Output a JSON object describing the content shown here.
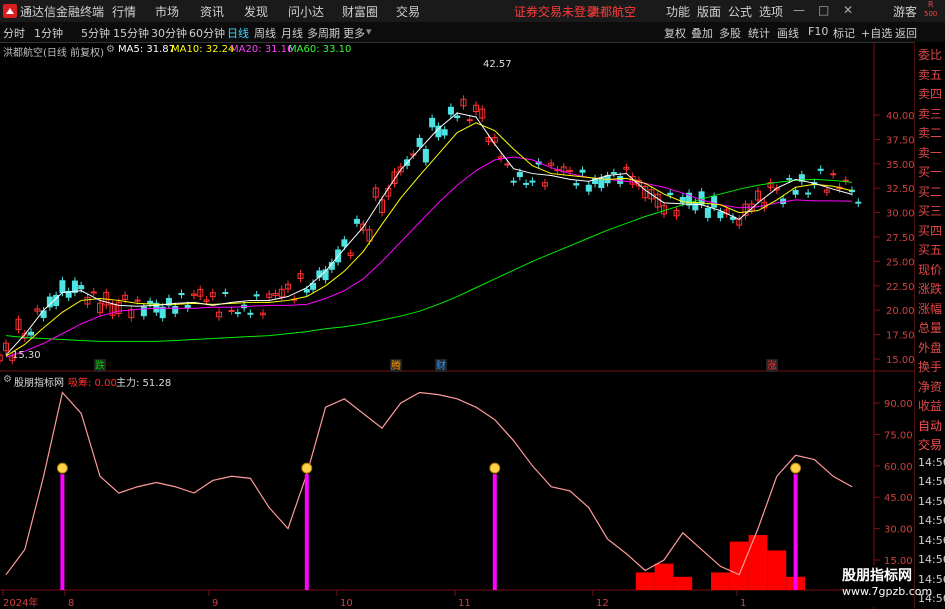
{
  "topbar": {
    "app_title": "通达信金融终端",
    "menu": [
      "行情",
      "市场",
      "资讯",
      "发现",
      "问小达",
      "财富圈",
      "交易"
    ],
    "account_status": "证券交易未登录",
    "stock_name": "洪都航空",
    "right_menu": [
      "功能",
      "版面",
      "公式",
      "选项"
    ],
    "guest": "游客",
    "r_label": "R",
    "r_num": "500"
  },
  "toolbar": {
    "periods": [
      "分时",
      "1分钟",
      "5分钟",
      "15分钟",
      "30分钟",
      "60分钟",
      "日线",
      "周线",
      "月线",
      "多周期",
      "更多"
    ],
    "active_period": "日线",
    "right_buttons": [
      "复权",
      "叠加",
      "多股",
      "统计",
      "画线",
      "F10",
      "标记",
      "+自选",
      "返回"
    ]
  },
  "chart_header": {
    "title": "洪都航空(日线 前复权)",
    "ma5": "MA5: 31.87",
    "ma10": "MA10: 32.24",
    "ma20": "MA20: 31.16",
    "ma60": "MA60: 33.10",
    "colors": {
      "ma5": "#ffffff",
      "ma10": "#ffff00",
      "ma20": "#ff00ff",
      "ma60": "#00ff00"
    }
  },
  "price_axis": [
    "40.00",
    "37.50",
    "35.00",
    "32.50",
    "30.00",
    "27.50",
    "25.00",
    "22.50",
    "20.00",
    "17.50",
    "15.00"
  ],
  "annotations": {
    "high": "42.57",
    "low": "15.30"
  },
  "event_markers": [
    {
      "label": "跌",
      "color": "#00cc00"
    },
    {
      "label": "腾",
      "color": "#ff9900"
    },
    {
      "label": "财",
      "color": "#3399ff"
    },
    {
      "label": "涨",
      "color": "#ff3030"
    }
  ],
  "indicator_header": {
    "name": "股朋指标网",
    "xi_label": "吸筹: 0.00",
    "main_label": "主力: 51.28"
  },
  "indicator_axis": [
    "90.00",
    "75.00",
    "60.00",
    "45.00",
    "30.00",
    "15.00"
  ],
  "date_axis": [
    "2024年",
    "8",
    "9",
    "10",
    "11",
    "12",
    "1"
  ],
  "right_panel": {
    "items": [
      "委比",
      "卖五",
      "卖四",
      "卖三",
      "卖二",
      "卖一",
      "买一",
      "买二",
      "买三",
      "买四",
      "买五",
      "现价",
      "涨跌",
      "涨幅",
      "总量",
      "外盘",
      "换手",
      "净资",
      "收益",
      "自动",
      "交易",
      "14:56",
      "14:56",
      "14:56",
      "14:56",
      "14:56",
      "14:56",
      "14:56",
      "14:56"
    ]
  },
  "watermark": {
    "cn": "股朋指标网",
    "url": "www.7gpzb.com"
  },
  "chart_data": {
    "type": "line",
    "x_note": "trading days Jul 2024 – Jan 2025 (daily)",
    "y_range": [
      14,
      43
    ],
    "series": [
      {
        "name": "MA60",
        "values": [
          17.4,
          17.2,
          17.1,
          17.0,
          16.9,
          16.8,
          16.8,
          16.8,
          16.8,
          16.9,
          17.0,
          17.1,
          17.2,
          17.3,
          17.4,
          17.6,
          17.8,
          18.1,
          18.3,
          18.6,
          19.0,
          19.4,
          19.9,
          20.6,
          21.4,
          22.3,
          23.2,
          24.1,
          25.0,
          25.8,
          26.6,
          27.4,
          28.2,
          28.9,
          29.6,
          30.2,
          30.8,
          31.4,
          31.9,
          32.4,
          32.8,
          33.1,
          33.3,
          33.4,
          33.3,
          33.1
        ]
      },
      {
        "name": "MA20",
        "values": [
          15.2,
          15.8,
          16.6,
          17.6,
          18.6,
          19.4,
          19.9,
          20.1,
          20.2,
          20.2,
          20.2,
          20.3,
          20.3,
          20.4,
          20.5,
          20.5,
          20.6,
          21.2,
          22.0,
          23.2,
          25.0,
          27.0,
          29.0,
          31.0,
          32.8,
          34.3,
          35.4,
          35.7,
          35.4,
          34.6,
          34.0,
          33.6,
          33.4,
          33.2,
          33.0,
          32.6,
          32.0,
          31.3,
          30.8,
          30.5,
          30.6,
          31.0,
          31.3,
          31.2,
          31.2,
          31.16
        ]
      },
      {
        "name": "MA10",
        "values": [
          15.3,
          16.5,
          18.2,
          19.8,
          21.0,
          21.2,
          21.0,
          20.7,
          20.6,
          20.6,
          20.7,
          20.6,
          20.7,
          20.8,
          20.8,
          21.0,
          21.4,
          22.5,
          24.0,
          26.0,
          28.8,
          31.5,
          33.8,
          36.0,
          38.2,
          39.2,
          38.4,
          36.5,
          34.8,
          34.0,
          33.8,
          33.6,
          33.4,
          33.5,
          33.0,
          31.9,
          31.1,
          31.0,
          30.8,
          30.0,
          30.2,
          31.3,
          32.6,
          32.9,
          32.7,
          32.24
        ]
      },
      {
        "name": "MA5",
        "values": [
          15.4,
          17.5,
          20.0,
          21.8,
          22.0,
          21.0,
          20.5,
          20.4,
          20.5,
          20.7,
          20.8,
          20.5,
          20.8,
          21.0,
          21.0,
          21.4,
          22.3,
          24.0,
          26.3,
          28.5,
          31.5,
          34.4,
          36.5,
          38.6,
          40.2,
          39.8,
          37.0,
          34.5,
          34.0,
          33.8,
          33.4,
          33.2,
          33.8,
          34.0,
          32.3,
          31.0,
          30.9,
          30.8,
          30.2,
          29.3,
          31.0,
          32.5,
          33.4,
          33.0,
          32.4,
          31.87
        ]
      },
      {
        "name": "指标",
        "values": [
          8,
          20,
          55,
          95,
          85,
          55,
          47,
          50,
          52,
          50,
          47,
          53,
          55,
          54,
          40,
          30,
          56,
          88,
          92,
          85,
          78,
          90,
          95,
          94,
          92,
          88,
          82,
          72,
          60,
          50,
          48,
          40,
          25,
          18,
          10,
          15,
          28,
          20,
          12,
          8,
          30,
          55,
          65,
          63,
          55,
          50
        ]
      }
    ],
    "bars_xi": [
      0,
      0,
      0,
      0,
      0,
      0,
      0,
      0,
      0,
      0,
      0,
      0,
      0,
      0,
      0,
      0,
      0,
      0,
      0,
      0,
      0,
      0,
      0,
      0,
      0,
      0,
      0,
      0,
      0,
      0,
      0,
      0,
      0,
      0,
      8,
      12,
      6,
      0,
      8,
      22,
      25,
      18,
      6,
      0,
      0,
      0
    ]
  }
}
